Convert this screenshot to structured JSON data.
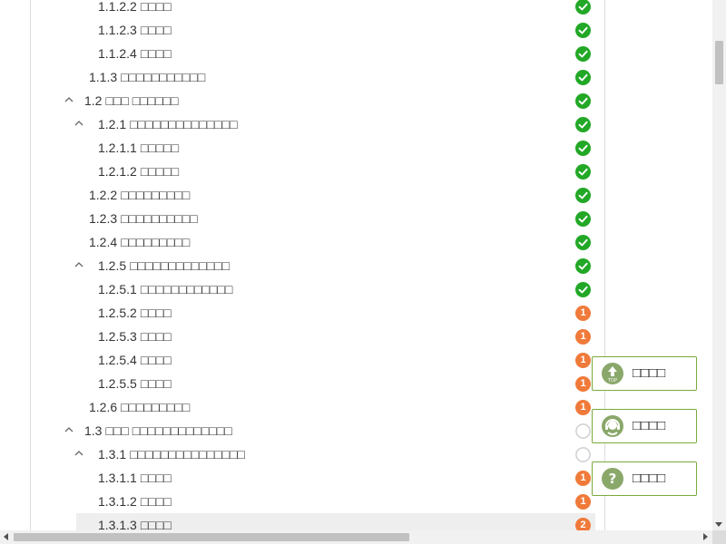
{
  "tree": [
    {
      "num": "1.1.2.2",
      "label": "□□□□",
      "level": 3,
      "status": "done"
    },
    {
      "num": "1.1.2.3",
      "label": "□□□□",
      "level": 3,
      "status": "done"
    },
    {
      "num": "1.1.2.4",
      "label": "□□□□",
      "level": 3,
      "status": "done"
    },
    {
      "num": "1.1.3",
      "label": "□□□□□□□□□□□",
      "level": 2,
      "status": "done"
    },
    {
      "num": "1.2",
      "label": "□□□ □□□□□□",
      "level": 1,
      "status": "done",
      "expanded": true
    },
    {
      "num": "1.2.1",
      "label": "□□□□□□□□□□□□□□",
      "level": 2,
      "status": "done",
      "expanded": true
    },
    {
      "num": "1.2.1.1",
      "label": "□□□□□",
      "level": 3,
      "status": "done"
    },
    {
      "num": "1.2.1.2",
      "label": "□□□□□",
      "level": 3,
      "status": "done"
    },
    {
      "num": "1.2.2",
      "label": "□□□□□□□□□",
      "level": 2,
      "status": "done"
    },
    {
      "num": "1.2.3",
      "label": "□□□□□□□□□□",
      "level": 2,
      "status": "done"
    },
    {
      "num": "1.2.4",
      "label": "□□□□□□□□□",
      "level": 2,
      "status": "done"
    },
    {
      "num": "1.2.5",
      "label": "□□□□□□□□□□□□□",
      "level": 2,
      "status": "done",
      "expanded": true
    },
    {
      "num": "1.2.5.1",
      "label": "□□□□□□□□□□□□",
      "level": 3,
      "status": "done"
    },
    {
      "num": "1.2.5.2",
      "label": "□□□□",
      "level": 3,
      "status": "count",
      "count": "1"
    },
    {
      "num": "1.2.5.3",
      "label": "□□□□",
      "level": 3,
      "status": "count",
      "count": "1"
    },
    {
      "num": "1.2.5.4",
      "label": "□□□□",
      "level": 3,
      "status": "count",
      "count": "1"
    },
    {
      "num": "1.2.5.5",
      "label": "□□□□",
      "level": 3,
      "status": "count",
      "count": "1"
    },
    {
      "num": "1.2.6",
      "label": "□□□□□□□□□",
      "level": 2,
      "status": "count",
      "count": "1"
    },
    {
      "num": "1.3",
      "label": "□□□ □□□□□□□□□□□□□",
      "level": 1,
      "status": "empty",
      "expanded": true
    },
    {
      "num": "1.3.1",
      "label": "□□□□□□□□□□□□□□□",
      "level": 2,
      "status": "empty",
      "expanded": true
    },
    {
      "num": "1.3.1.1",
      "label": "□□□□",
      "level": 3,
      "status": "count",
      "count": "1"
    },
    {
      "num": "1.3.1.2",
      "label": "□□□□",
      "level": 3,
      "status": "count",
      "count": "1"
    },
    {
      "num": "1.3.1.3",
      "label": "□□□□",
      "level": 3,
      "status": "count",
      "count": "2",
      "highlighted": true
    }
  ],
  "side_buttons": [
    {
      "id": "top",
      "label": "□□□□",
      "icon": "back-to-top-icon",
      "icon_text": "TOP"
    },
    {
      "id": "service",
      "label": "□□□□",
      "icon": "customer-service-icon"
    },
    {
      "id": "help",
      "label": "□□□□",
      "icon": "help-icon",
      "icon_text": "?"
    }
  ],
  "colors": {
    "done": "#22a826",
    "badge": "#f07a3a",
    "empty_ring": "#cfcfcf",
    "accent_green": "#7aa93c"
  }
}
